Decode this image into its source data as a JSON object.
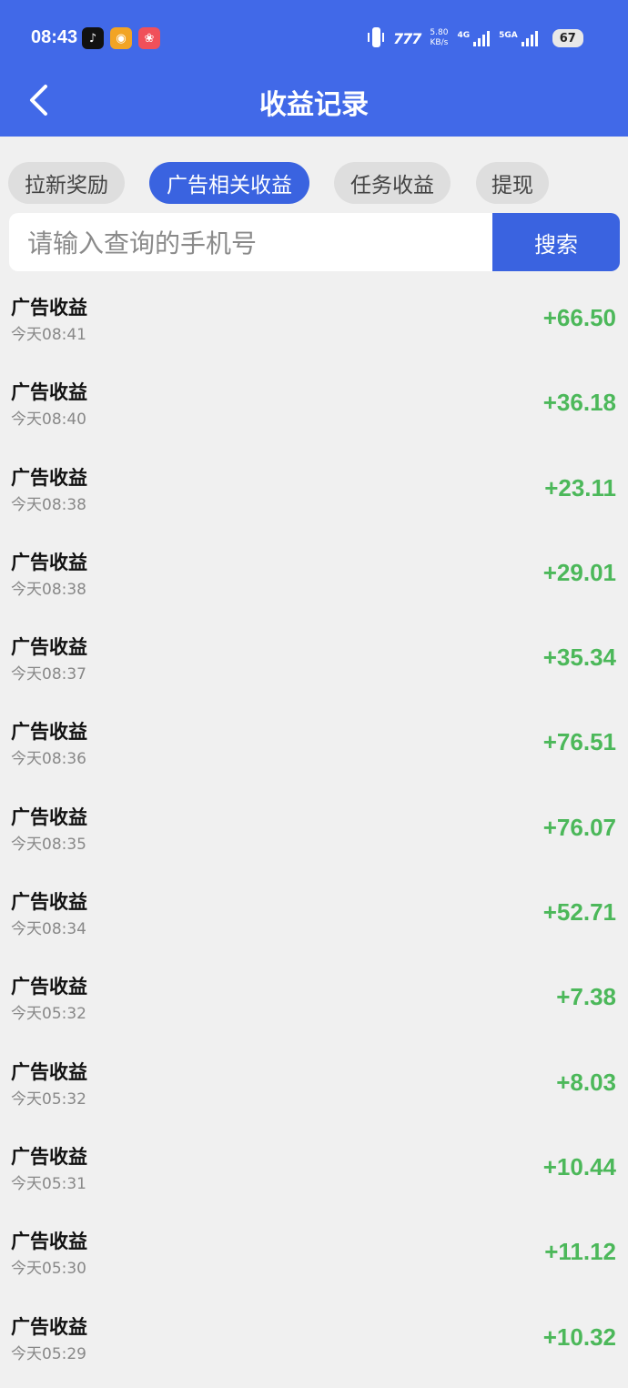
{
  "status_bar": {
    "time": "08:43",
    "app_icons": [
      {
        "name": "tiktok-icon",
        "glyph": "♪",
        "color": "#111111"
      },
      {
        "name": "map-app-icon",
        "glyph": "◉",
        "color": "#f2a424"
      },
      {
        "name": "gallery-app-icon",
        "glyph": "❀",
        "color": "#f0505a"
      }
    ],
    "net_speed_value": "5.80",
    "net_speed_unit": "KB/s",
    "signal1_label": "4G",
    "signal2_label": "5GA",
    "battery": "67"
  },
  "header": {
    "title": "收益记录"
  },
  "tabs": [
    {
      "label": "拉新奖励",
      "active": false
    },
    {
      "label": "广告相关收益",
      "active": true
    },
    {
      "label": "任务收益",
      "active": false
    },
    {
      "label": "提现",
      "active": false
    }
  ],
  "search": {
    "placeholder": "请输入查询的手机号",
    "value": "",
    "button_label": "搜索"
  },
  "records": [
    {
      "title": "广告收益",
      "time": "今天08:41",
      "amount": "+66.50"
    },
    {
      "title": "广告收益",
      "time": "今天08:40",
      "amount": "+36.18"
    },
    {
      "title": "广告收益",
      "time": "今天08:38",
      "amount": "+23.11"
    },
    {
      "title": "广告收益",
      "time": "今天08:38",
      "amount": "+29.01"
    },
    {
      "title": "广告收益",
      "time": "今天08:37",
      "amount": "+35.34"
    },
    {
      "title": "广告收益",
      "time": "今天08:36",
      "amount": "+76.51"
    },
    {
      "title": "广告收益",
      "time": "今天08:35",
      "amount": "+76.07"
    },
    {
      "title": "广告收益",
      "time": "今天08:34",
      "amount": "+52.71"
    },
    {
      "title": "广告收益",
      "time": "今天05:32",
      "amount": "+7.38"
    },
    {
      "title": "广告收益",
      "time": "今天05:32",
      "amount": "+8.03"
    },
    {
      "title": "广告收益",
      "time": "今天05:31",
      "amount": "+10.44"
    },
    {
      "title": "广告收益",
      "time": "今天05:30",
      "amount": "+11.12"
    },
    {
      "title": "广告收益",
      "time": "今天05:29",
      "amount": "+10.32"
    }
  ],
  "colors": {
    "primary": "#4169e8",
    "accent_button": "#3a63e0",
    "positive_amount": "#4cb85a",
    "background": "#f0f0f0"
  }
}
